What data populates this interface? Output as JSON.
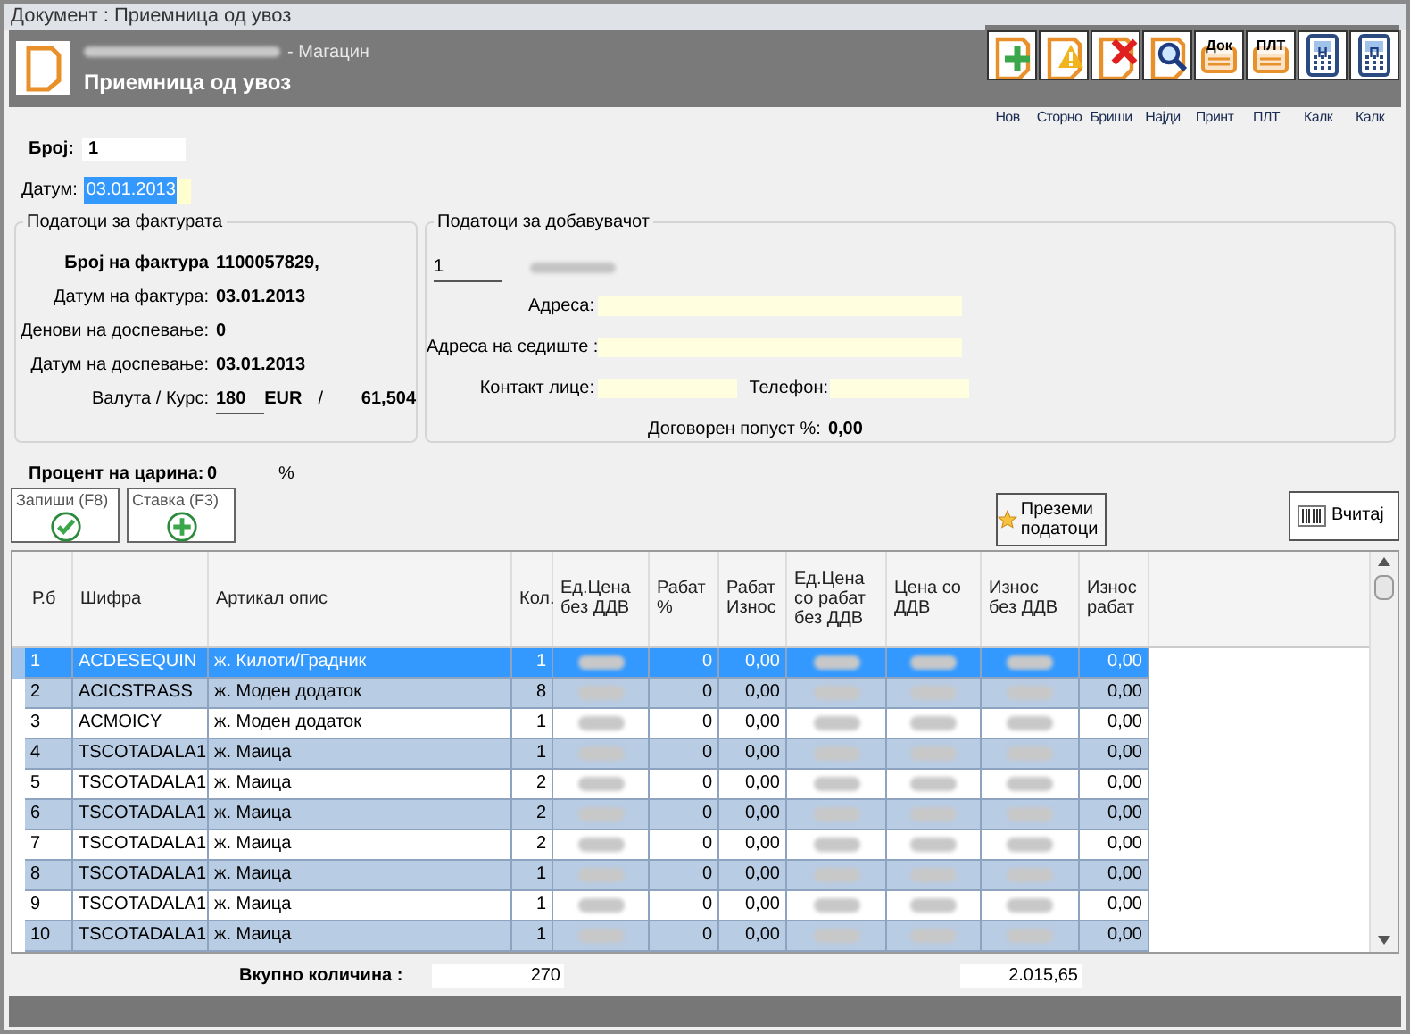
{
  "window": {
    "title": "Документ : Приемница од увоз"
  },
  "header": {
    "subtitle": "- Магацин",
    "title": "Приемница од увоз"
  },
  "toolbar": [
    {
      "label": "Нов",
      "kind": "new"
    },
    {
      "label": "Сторно",
      "kind": "storno"
    },
    {
      "label": "Бриши",
      "kind": "delete"
    },
    {
      "label": "Најди",
      "kind": "find"
    },
    {
      "label": "Принт",
      "kind": "print",
      "icon_text": "Док"
    },
    {
      "label": "ПЛТ",
      "kind": "print",
      "icon_text": "ПЛТ"
    },
    {
      "label": "Калк",
      "kind": "calc",
      "icon_text": "Н"
    },
    {
      "label": "Калк",
      "kind": "calc",
      "icon_text": "П"
    }
  ],
  "number": {
    "label": "Број:",
    "value": "1"
  },
  "date": {
    "label": "Датум:",
    "value": "03.01.2013"
  },
  "invoice": {
    "title": "Податоци за фактурата",
    "fields": [
      {
        "label": "Број на фактура",
        "value": "1100057829,",
        "bold_label": true
      },
      {
        "label": "Датум на фактура:",
        "value": "03.01.2013",
        "bold_label": false
      },
      {
        "label": "Денови на доспевање:",
        "value": "0",
        "bold_label": false
      },
      {
        "label": "Датум на доспевање:",
        "value": "03.01.2013",
        "bold_label": false
      }
    ],
    "currency": {
      "label": "Валута / Курс:",
      "code": "180",
      "name": "EUR",
      "separator": "/",
      "rate": "61,504"
    }
  },
  "supplier": {
    "title": "Податоци за добавувачот",
    "code": "1",
    "address_label": "Адреса:",
    "seat_label": "Адреса на седиште :",
    "contact_label": "Контакт лице:",
    "phone_label": "Телефон:",
    "discount_label": "Договорен попуст %:",
    "discount": "0,00"
  },
  "customs": {
    "label": "Процент на царина:",
    "value": "0",
    "unit": "%"
  },
  "buttons": [
    {
      "label": "Запиши (F8)",
      "kind": "check"
    },
    {
      "label": "Ставка (F3)",
      "kind": "plus"
    }
  ],
  "fetch_button": {
    "label": "Преземи податоци"
  },
  "load_button": {
    "label": "Вчитај"
  },
  "table": {
    "columns": [
      "Р.б",
      "Шифра",
      "Артикал опис",
      "Кол.",
      "Ед.Цена без ДДВ",
      "Рабат %",
      "Рабат Износ",
      "Ед.Цена со рабат без ДДВ",
      "Цена со ДДВ",
      "Износ без ДДВ",
      "Износ рабат"
    ],
    "rows": [
      {
        "selected": true,
        "cells": [
          "1",
          "ACDESEQUIN",
          "ж. Килоти/Градник",
          "1",
          "",
          "0",
          "0,00",
          "",
          "",
          "",
          "0,00"
        ]
      },
      {
        "selected": false,
        "cells": [
          "2",
          "ACICSTRASS",
          "ж. Моден додаток",
          "8",
          "",
          "0",
          "0,00",
          "",
          "",
          "",
          "0,00"
        ]
      },
      {
        "selected": false,
        "cells": [
          "3",
          "ACMOICY",
          "ж. Моден додаток",
          "1",
          "",
          "0",
          "0,00",
          "",
          "",
          "",
          "0,00"
        ]
      },
      {
        "selected": false,
        "cells": [
          "4",
          "TSCOTADALA1",
          "ж. Маица",
          "1",
          "",
          "0",
          "0,00",
          "",
          "",
          "",
          "0,00"
        ]
      },
      {
        "selected": false,
        "cells": [
          "5",
          "TSCOTADALA1",
          "ж. Маица",
          "2",
          "",
          "0",
          "0,00",
          "",
          "",
          "",
          "0,00"
        ]
      },
      {
        "selected": false,
        "cells": [
          "6",
          "TSCOTADALA1",
          "ж. Маица",
          "2",
          "",
          "0",
          "0,00",
          "",
          "",
          "",
          "0,00"
        ]
      },
      {
        "selected": false,
        "cells": [
          "7",
          "TSCOTADALA1",
          "ж. Маица",
          "2",
          "",
          "0",
          "0,00",
          "",
          "",
          "",
          "0,00"
        ]
      },
      {
        "selected": false,
        "cells": [
          "8",
          "TSCOTADALA1",
          "ж. Маица",
          "1",
          "",
          "0",
          "0,00",
          "",
          "",
          "",
          "0,00"
        ]
      },
      {
        "selected": false,
        "cells": [
          "9",
          "TSCOTADALA1",
          "ж. Маица",
          "1",
          "",
          "0",
          "0,00",
          "",
          "",
          "",
          "0,00"
        ]
      },
      {
        "selected": false,
        "cells": [
          "10",
          "TSCOTADALA1",
          "ж. Маица",
          "1",
          "",
          "0",
          "0,00",
          "",
          "",
          "",
          "0,00"
        ]
      }
    ]
  },
  "totals": {
    "label": "Вкупно количина :",
    "quantity": "270",
    "amount": "2.015,65"
  }
}
